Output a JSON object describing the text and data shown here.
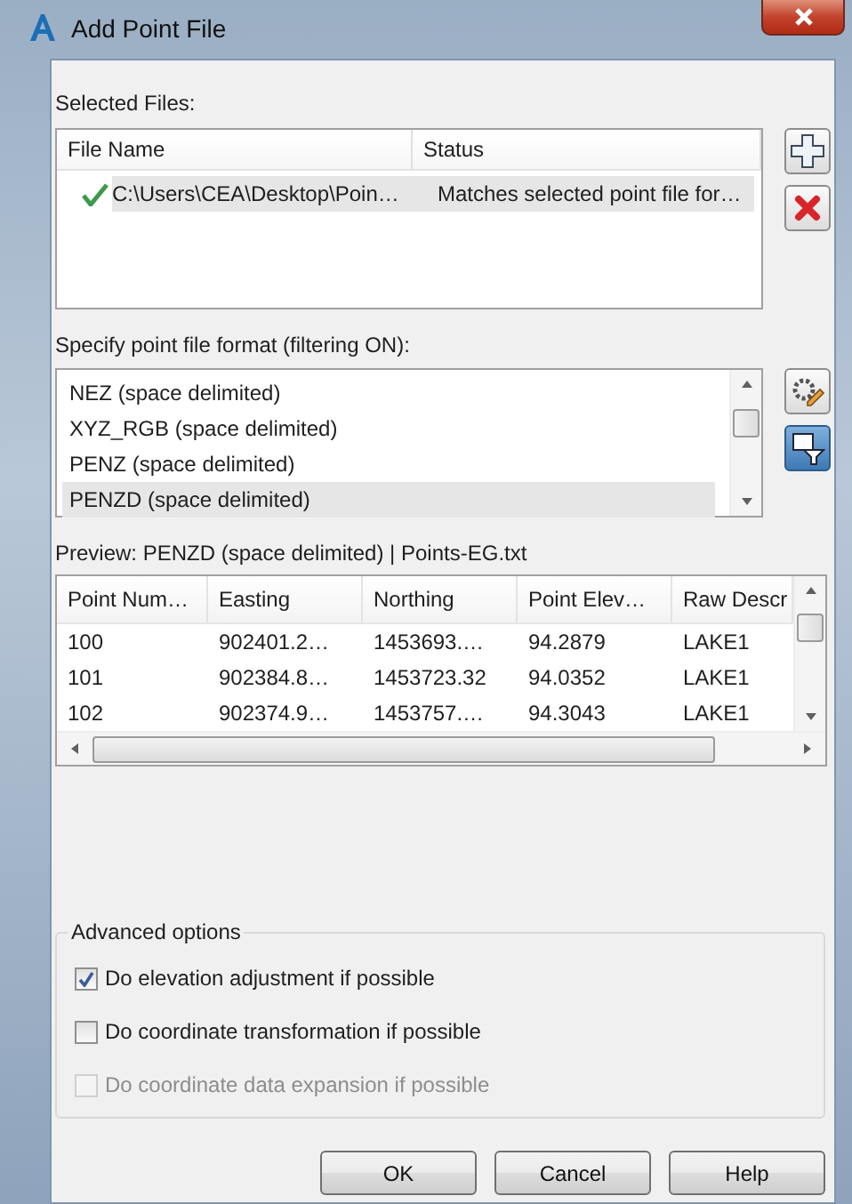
{
  "window": {
    "title": "Add Point File"
  },
  "selected_files": {
    "label": "Selected Files:",
    "columns": [
      "File Name",
      "Status"
    ],
    "rows": [
      {
        "file_name": "C:\\Users\\CEA\\Desktop\\Poin…",
        "status": "Matches selected point file for…",
        "selected": true
      }
    ],
    "tools": [
      {
        "kind": "add",
        "pressed": false
      },
      {
        "kind": "remove",
        "pressed": false
      }
    ]
  },
  "format": {
    "label": "Specify point file format (filtering ON):",
    "items": [
      {
        "label": "NEZ (space delimited)",
        "selected": false
      },
      {
        "label": "XYZ_RGB (space delimited)",
        "selected": false
      },
      {
        "label": "PENZ (space delimited)",
        "selected": false
      },
      {
        "label": "PENZD (space delimited)",
        "selected": true
      }
    ],
    "tools": [
      {
        "kind": "edit",
        "pressed": false
      },
      {
        "kind": "filter",
        "pressed": true
      }
    ]
  },
  "preview": {
    "label": "Preview: PENZD (space delimited) | Points-EG.txt",
    "columns": [
      "Point Num…",
      "Easting",
      "Northing",
      "Point Elev…",
      "Raw Descr"
    ],
    "rows": [
      [
        "100",
        "902401.2…",
        "1453693.…",
        "94.2879",
        "LAKE1"
      ],
      [
        "101",
        "902384.8…",
        "1453723.32",
        "94.0352",
        "LAKE1"
      ],
      [
        "102",
        "902374.9…",
        "1453757.…",
        "94.3043",
        "LAKE1"
      ]
    ]
  },
  "advanced": {
    "legend": "Advanced options",
    "options": [
      {
        "label": "Do elevation adjustment if possible",
        "checked": true,
        "disabled": false
      },
      {
        "label": "Do coordinate transformation if possible",
        "checked": false,
        "disabled": false
      },
      {
        "label": "Do coordinate data expansion if possible",
        "checked": false,
        "disabled": true
      }
    ]
  },
  "buttons": [
    "OK",
    "Cancel",
    "Help"
  ]
}
